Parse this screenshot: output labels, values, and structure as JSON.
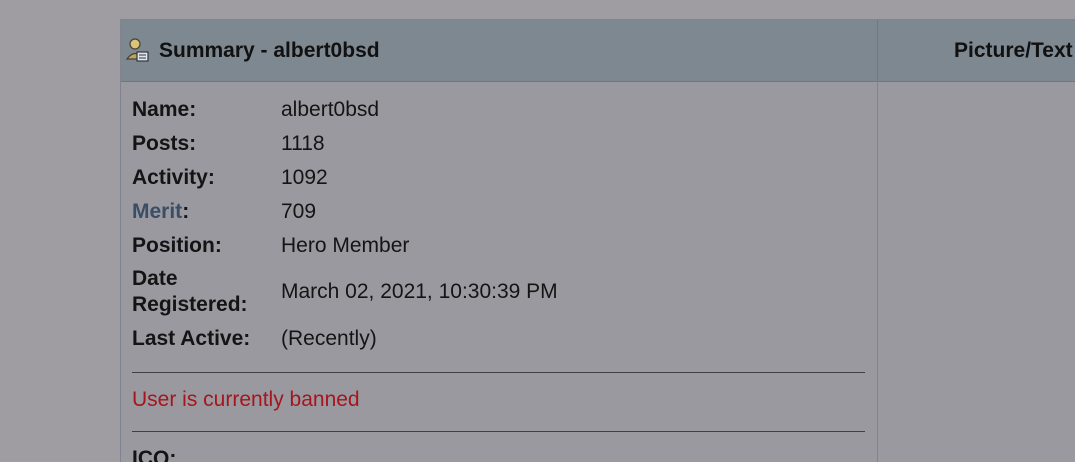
{
  "header": {
    "summary_title": "Summary - albert0bsd",
    "picture_title": "Picture/Text"
  },
  "details": {
    "name_label": "Name:",
    "name_value": "albert0bsd",
    "posts_label": "Posts:",
    "posts_value": "1118",
    "activity_label": "Activity:",
    "activity_value": "1092",
    "merit_label": "Merit",
    "merit_colon": ":",
    "merit_value": "709",
    "position_label": "Position:",
    "position_value": "Hero Member",
    "date_label": "Date Registered:",
    "date_value": "March 02, 2021, 10:30:39 PM",
    "last_active_label": "Last Active:",
    "last_active_value": "(Recently)"
  },
  "status": {
    "banned_text": "User is currently banned",
    "color": "#a6151c"
  },
  "next_section_label": "ICQ:",
  "icons": {
    "summary_icon": "user-profile-icon"
  },
  "colors": {
    "header_bg": "#7e8891",
    "body_bg": "#9b99a0",
    "merit_link": "#3a4e66"
  }
}
